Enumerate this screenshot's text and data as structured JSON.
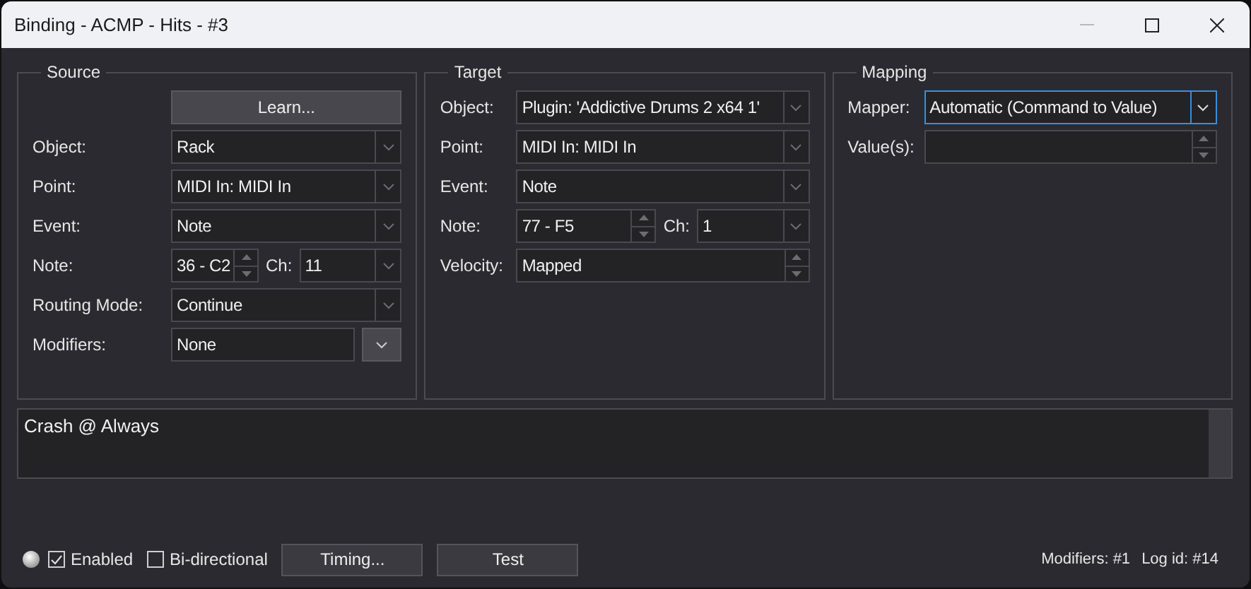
{
  "window": {
    "title": "Binding - ACMP - Hits - #3"
  },
  "groups": [
    {
      "title": "Source",
      "rows": [
        {
          "kind": "button",
          "label": "Learn..."
        },
        {
          "kind": "combo",
          "label": "Object:",
          "value": "Rack"
        },
        {
          "kind": "combo",
          "label": "Point:",
          "value": "MIDI In: MIDI In"
        },
        {
          "kind": "combo",
          "label": "Event:",
          "value": "Note"
        },
        {
          "kind": "note",
          "label": "Note:",
          "value": "36 - C2",
          "channel_label": "Ch:",
          "channel": "11"
        },
        {
          "kind": "combo",
          "label": "Routing Mode:",
          "value": "Continue"
        },
        {
          "kind": "dropdown",
          "label": "Modifiers:",
          "value": "None"
        }
      ]
    },
    {
      "title": "Target",
      "rows": [
        {
          "kind": "combo",
          "label": "Object:",
          "value": "Plugin: 'Addictive Drums 2 x64 1'"
        },
        {
          "kind": "combo",
          "label": "Point:",
          "value": "MIDI In: MIDI In"
        },
        {
          "kind": "combo",
          "label": "Event:",
          "value": "Note"
        },
        {
          "kind": "note",
          "label": "Note:",
          "value": "77 - F5",
          "channel_label": "Ch:",
          "channel": "1"
        },
        {
          "kind": "spin",
          "label": "Velocity:",
          "value": "Mapped"
        }
      ]
    },
    {
      "title": "Mapping",
      "rows": [
        {
          "kind": "combo",
          "label": "Mapper:",
          "value": "Automatic (Command to Value)",
          "focused": true
        },
        {
          "kind": "spin",
          "label": "Value(s):"
        }
      ]
    }
  ],
  "notes": "Crash @ Always",
  "footer": {
    "checkboxes": [
      {
        "label": "Enabled",
        "checked": true
      },
      {
        "label": "Bi-directional",
        "checked": false
      }
    ],
    "buttons": [
      "Timing...",
      "Test"
    ],
    "status": [
      "Modifiers: #1",
      "Log id: #14"
    ]
  }
}
